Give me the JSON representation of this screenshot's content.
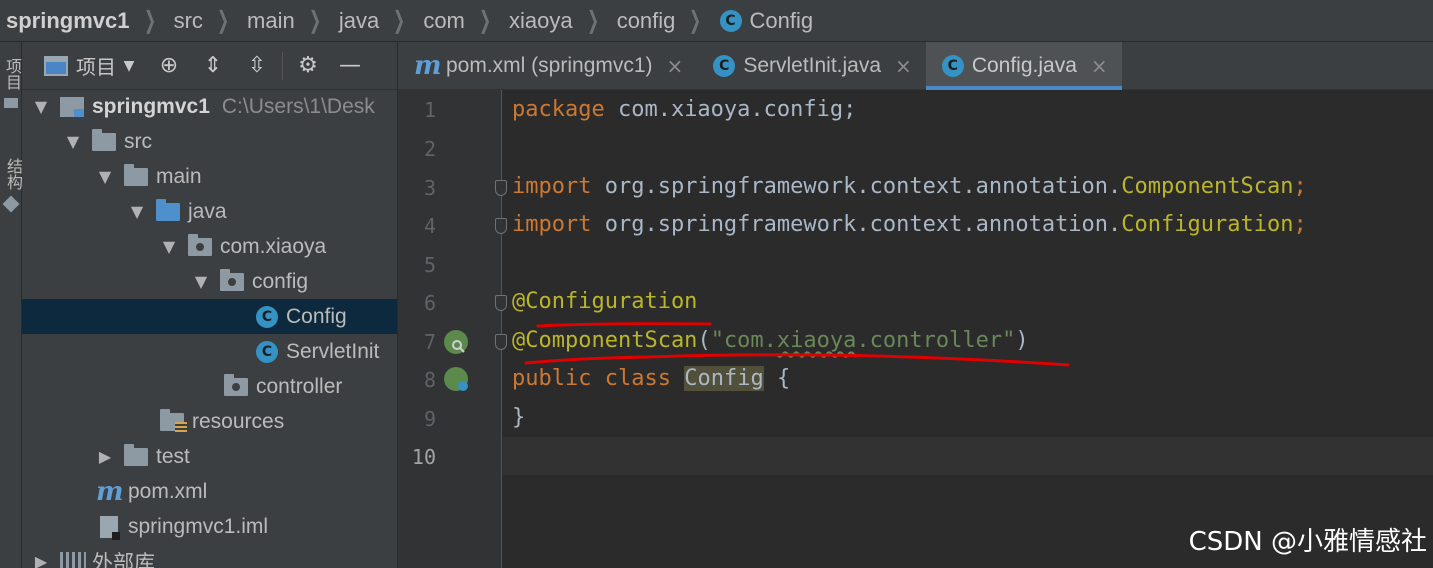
{
  "breadcrumb": [
    "springmvc1",
    "src",
    "main",
    "java",
    "com",
    "xiaoya",
    "config",
    "Config"
  ],
  "tool_strip": {
    "top_tab": "项目",
    "bottom_tab": "结构"
  },
  "project_toolbar": {
    "label": "项目"
  },
  "tree": [
    {
      "label": "springmvc1",
      "path": "C:\\Users\\1\\Desk",
      "icon": "module-folder-icon",
      "expanded": true
    },
    {
      "label": "src",
      "icon": "folder-icon",
      "expanded": true
    },
    {
      "label": "main",
      "icon": "folder-icon",
      "expanded": true
    },
    {
      "label": "java",
      "icon": "source-folder-icon",
      "expanded": true
    },
    {
      "label": "com.xiaoya",
      "icon": "package-icon",
      "expanded": true
    },
    {
      "label": "config",
      "icon": "package-icon",
      "expanded": true
    },
    {
      "label": "Config",
      "icon": "class-icon",
      "selected": true
    },
    {
      "label": "ServletInit",
      "icon": "class-icon"
    },
    {
      "label": "controller",
      "icon": "package-icon"
    },
    {
      "label": "resources",
      "icon": "resources-folder-icon"
    },
    {
      "label": "test",
      "icon": "folder-icon",
      "expanded": false
    },
    {
      "label": "pom.xml",
      "icon": "maven-icon"
    },
    {
      "label": "springmvc1.iml",
      "icon": "iml-file-icon"
    },
    {
      "label": "外部库",
      "icon": "library-icon",
      "expanded": false
    }
  ],
  "tabs": [
    {
      "label": "pom.xml (springmvc1)",
      "icon": "maven-icon",
      "close": "×",
      "active": false
    },
    {
      "label": "ServletInit.java",
      "icon": "class-icon",
      "close": "×",
      "active": false
    },
    {
      "label": "Config.java",
      "icon": "class-icon",
      "close": "×",
      "active": true
    }
  ],
  "class_icon_letter": "C",
  "maven_icon_letter": "m",
  "code": {
    "line_numbers": [
      "1",
      "2",
      "3",
      "4",
      "5",
      "6",
      "7",
      "8",
      "9",
      "10"
    ],
    "l1": {
      "kw": "package",
      "rest": " com.xiaoya.config;"
    },
    "l3": {
      "kw": "import",
      "pkg": " org.springframework.context.annotation.",
      "cls": "ComponentScan",
      "end": ";"
    },
    "l4": {
      "kw": "import",
      "pkg": " org.springframework.context.annotation.",
      "cls": "Configuration",
      "end": ";"
    },
    "l6": {
      "ann": "@Configuration"
    },
    "l7": {
      "ann": "@ComponentScan",
      "open": "(",
      "str_a": "\"com.",
      "str_b": "xiaoya",
      "str_c": ".controller\"",
      "close": ")"
    },
    "l8": {
      "kw1": "public",
      "kw2": " class",
      "space": " ",
      "cls": "Config",
      "brace": " {"
    },
    "l9": {
      "text": "}"
    }
  },
  "watermark": "CSDN @小雅情感社",
  "colors": {
    "keyword": "#cc7832",
    "annotation": "#bbb529",
    "string": "#6a8759",
    "text": "#a9b7c6",
    "accent": "#4a88c7",
    "annotation_underline": "#e00000"
  }
}
